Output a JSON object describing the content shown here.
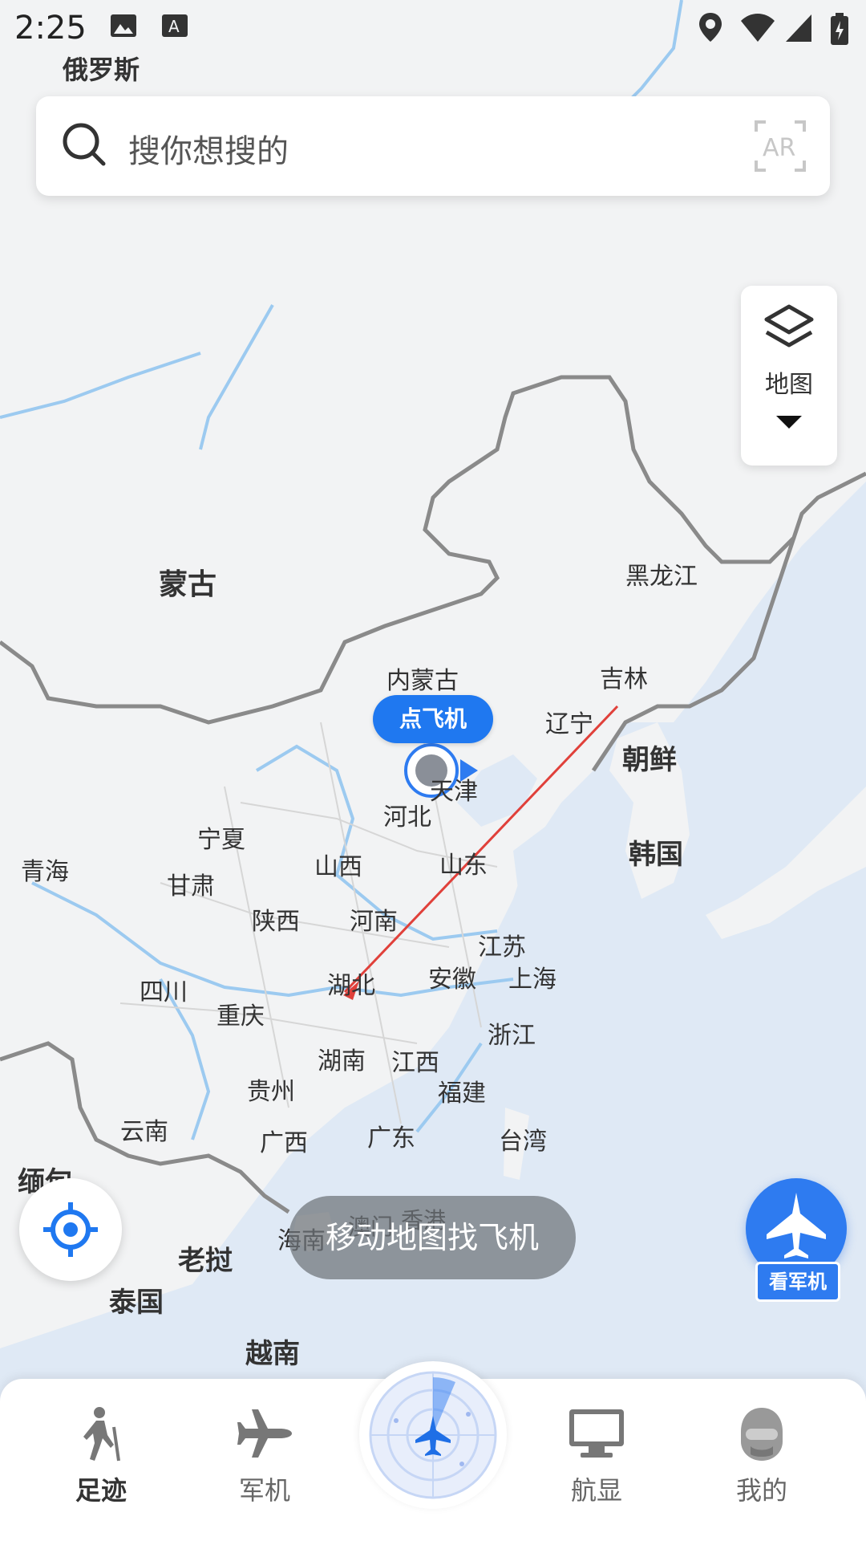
{
  "status_bar": {
    "time": "2:25",
    "icons": [
      "image-icon",
      "text-icon",
      "location-icon",
      "wifi-icon",
      "signal-icon",
      "battery-icon"
    ]
  },
  "search": {
    "placeholder": "搜你想搜的",
    "ar_label": "AR"
  },
  "layer_control": {
    "label": "地图"
  },
  "map": {
    "labels": {
      "russia": "俄罗斯",
      "mongolia": "蒙古",
      "heilongjiang": "黑龙江",
      "jilin": "吉林",
      "liaoning": "辽宁",
      "inner_mongolia": "内蒙古",
      "north_korea": "朝鲜",
      "south_korea": "韩国",
      "tianjin": "天津",
      "hebei": "河北",
      "ningxia": "宁夏",
      "qinghai": "青海",
      "gansu": "甘肃",
      "shanxi": "山西",
      "shandong": "山东",
      "shaanxi": "陕西",
      "henan": "河南",
      "jiangsu": "江苏",
      "sichuan": "四川",
      "hubei": "湖北",
      "anhui": "安徽",
      "shanghai": "上海",
      "chongqing": "重庆",
      "zhejiang": "浙江",
      "hunan": "湖南",
      "jiangxi": "江西",
      "guizhou": "贵州",
      "fujian": "福建",
      "yunnan": "云南",
      "guangxi": "广西",
      "guangdong": "广东",
      "taiwan": "台湾",
      "myanmar": "缅甸",
      "macau": "澳门",
      "hongkong": "香港",
      "hainan": "海南",
      "laos": "老挝",
      "thailand": "泰国",
      "vietnam": "越南"
    },
    "plane_callout": "点飞机",
    "hint": "移动地图找飞机"
  },
  "military_button": {
    "label": "看军机"
  },
  "bottom_nav": {
    "items": [
      {
        "label": "足迹",
        "icon": "hiker-icon",
        "active": true
      },
      {
        "label": "军机",
        "icon": "airplane-icon",
        "active": false
      },
      {
        "label": "",
        "icon": "radar-icon",
        "active": false
      },
      {
        "label": "航显",
        "icon": "monitor-icon",
        "active": false
      },
      {
        "label": "我的",
        "icon": "pilot-avatar-icon",
        "active": false
      }
    ]
  },
  "colors": {
    "accent": "#2e7bf0",
    "route": "#e0403a",
    "sea": "#dfe9f5",
    "land": "#f2f3f4",
    "border": "#8a8a8a",
    "river": "#9ccaf0"
  }
}
